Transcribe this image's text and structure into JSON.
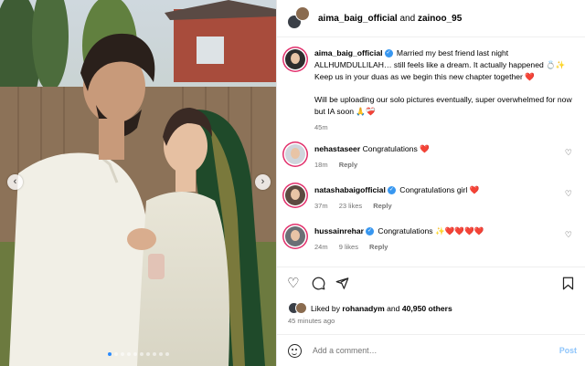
{
  "header": {
    "user1": "aima_baig_official",
    "joiner": "and",
    "user2": "zainoo_95"
  },
  "caption": {
    "username": "aima_baig_official",
    "text1": "Married my best friend last night ALLHUMDULLILAH… still feels like a dream. It actually happened 💍✨ Keep us in your duas as we begin this new chapter together ❤️",
    "text2": "Will be uploading our solo pictures eventually, super overwhelmed for now but IA soon 🙏❤️‍🩹",
    "time": "45m"
  },
  "comments": [
    {
      "username": "nehastaseer",
      "text": "Congratulations",
      "emoji": "❤️",
      "time": "18m",
      "likes": "",
      "reply": "Reply"
    },
    {
      "username": "natashabaigofficial",
      "text": "Congratulations girl",
      "emoji": "❤️",
      "time": "37m",
      "likes": "23 likes",
      "reply": "Reply"
    },
    {
      "username": "hussainrehar",
      "text": "Congratulations",
      "emoji": "✨❤️❤️❤️❤️",
      "time": "24m",
      "likes": "9 likes",
      "reply": "Reply"
    }
  ],
  "likes": {
    "prefix": "Liked by",
    "user": "rohanadym",
    "joiner": "and",
    "count": "40,950 others"
  },
  "posted_ago": "45 minutes ago",
  "composer": {
    "placeholder": "Add a comment…",
    "post_label": "Post"
  },
  "carousel": {
    "dot_count": 10,
    "active_index": 0
  },
  "icons": {
    "prev": "chevron-left-icon",
    "next": "chevron-right-icon",
    "like": "heart-icon",
    "comment": "comment-icon",
    "share": "send-icon",
    "save": "bookmark-icon"
  },
  "colors": {
    "accent": "#3897f0",
    "heart": "#e0102a",
    "post_disabled": "#8ec5fb"
  }
}
